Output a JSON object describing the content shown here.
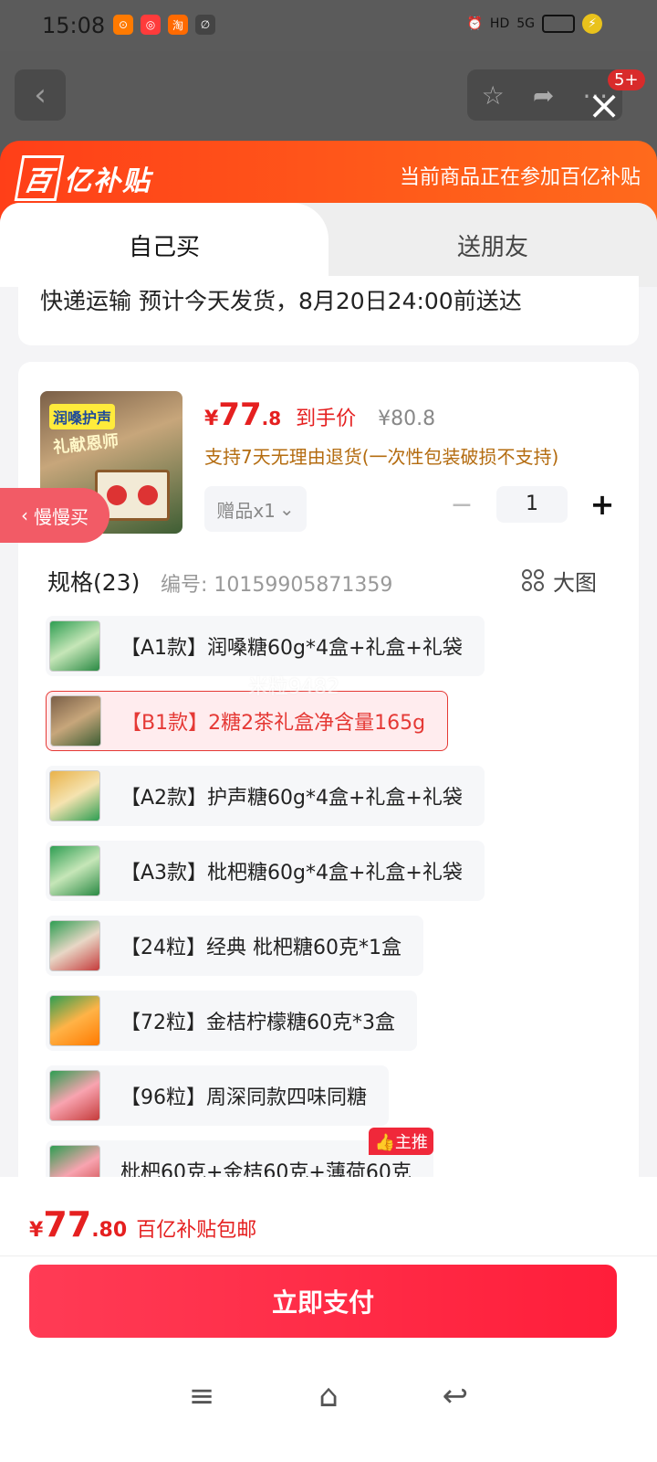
{
  "status_bar": {
    "time": "15:08",
    "network": "5G",
    "hd": "HD",
    "app_icons": [
      {
        "label": "⊙",
        "color": "#ff7a00"
      },
      {
        "label": "◎",
        "color": "#ff3b3b"
      },
      {
        "label": "淘",
        "color": "#ff6a00"
      },
      {
        "label": "∅",
        "color": "#444444"
      }
    ]
  },
  "page_nav": {
    "back_icon": "‹",
    "badge": "5+"
  },
  "header": {
    "brand": "百亿补贴",
    "brand_mark": "百",
    "brand_rest": "亿补贴",
    "notice": "当前商品正在参加百亿补贴"
  },
  "tabs": [
    {
      "label": "自己买",
      "active": true
    },
    {
      "label": "送朋友",
      "active": false
    }
  ],
  "delivery": {
    "text": "快递运输 预计今天发货，8月20日24:00前送达"
  },
  "product": {
    "thumb_tag": "润嗓护声",
    "thumb_sub": "礼献恩师",
    "price_yen": "¥",
    "price_int": "77",
    "price_dec": ".8",
    "price_label": "到手价",
    "old_price": "¥80.8",
    "return_policy": "支持7天无理由退货(一次性包装破损不支持)",
    "gift": "赠品x1",
    "quantity": "1"
  },
  "specs": {
    "title": "规格(23)",
    "id_label": "编号: 10159905871359",
    "big_view": "大图",
    "variants": [
      {
        "label": "【A1款】润嗓糖60g*4盒+礼盒+礼袋",
        "selected": false
      },
      {
        "label": "【B1款】2糖2茶礼盒净含量165g",
        "selected": true
      },
      {
        "label": "【A2款】护声糖60g*4盒+礼盒+礼袋",
        "selected": false
      },
      {
        "label": "【A3款】枇杷糖60g*4盒+礼盒+礼袋",
        "selected": false
      },
      {
        "label": "【24粒】经典 枇杷糖60克*1盒",
        "selected": false
      },
      {
        "label": "【72粒】金桔柠檬糖60克*3盒",
        "selected": false
      },
      {
        "label": "【96粒】周深同款四味同糖",
        "selected": false
      },
      {
        "label": "枇杷60克+金桔60克+薄荷60克",
        "selected": false
      }
    ],
    "recommend_badge": "主推"
  },
  "watermark": "米粒9482",
  "slow_buy": "慢慢买",
  "bottom": {
    "price_yen": "¥",
    "price_int": "77",
    "price_dec": ".80",
    "note": "百亿补贴包邮",
    "pay_button": "立即支付"
  },
  "colors": {
    "accent": "#e52020",
    "header_gradient_start": "#ff3f18",
    "pay_button": "#ff1e3a",
    "policy_text": "#b46c10"
  }
}
